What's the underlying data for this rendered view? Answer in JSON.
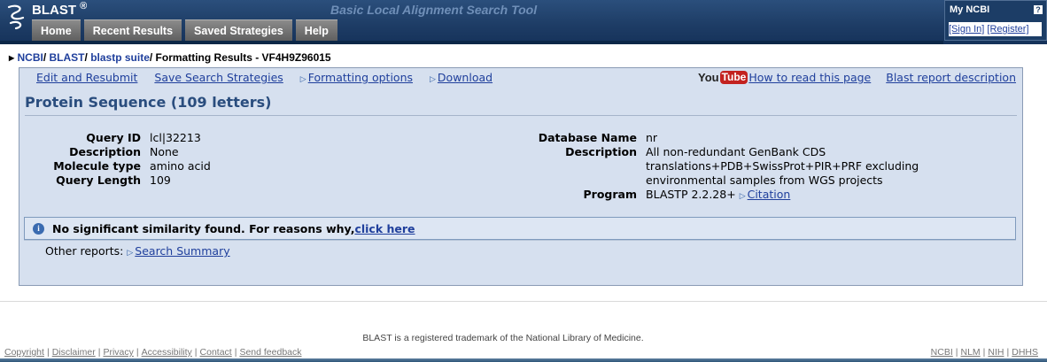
{
  "header": {
    "brand": "BLAST",
    "brand_mark": "®",
    "tool_title": "Basic Local Alignment Search Tool",
    "nav": [
      "Home",
      "Recent Results",
      "Saved Strategies",
      "Help"
    ],
    "my_ncbi": {
      "title": "My NCBI",
      "help": "?",
      "sign_in": "[Sign In]",
      "register": "[Register]"
    },
    "colors": {
      "header_bg": "#1e3d66",
      "tab_bg": "#6e6e6e",
      "panel_bg": "#d6e0ef",
      "link": "#1f3f9c"
    }
  },
  "breadcrumb": {
    "items": [
      "NCBI",
      "BLAST",
      "blastp suite"
    ],
    "current": "Formatting Results - VF4H9Z96015"
  },
  "toolbar": {
    "edit_resubmit": "Edit and Resubmit",
    "save_strategies": "Save Search Strategies",
    "formatting_options": "Formatting options",
    "download": "Download",
    "youtube_you": "You",
    "youtube_tube": "Tube",
    "how_to_read": "How to read this page",
    "report_description": "Blast report description"
  },
  "main": {
    "title": "Protein Sequence (109 letters)",
    "query_info": [
      {
        "label": "Query ID",
        "value": "lcl|32213"
      },
      {
        "label": "Description",
        "value": "None"
      },
      {
        "label": "Molecule type",
        "value": "amino acid"
      },
      {
        "label": "Query Length",
        "value": "109"
      }
    ],
    "db_info": {
      "db_name_label": "Database Name",
      "db_name": "nr",
      "description_label": "Description",
      "description": "All non-redundant GenBank CDS translations+PDB+SwissProt+PIR+PRF excluding environmental samples from WGS projects",
      "program_label": "Program",
      "program": "BLASTP 2.2.28+",
      "citation": "Citation"
    },
    "notice": {
      "icon": "i",
      "text": "No significant similarity found. For reasons why,",
      "link": "click here"
    },
    "other_reports": {
      "label": "Other reports:",
      "link": "Search Summary"
    }
  },
  "footer": {
    "trademark": "BLAST is a registered trademark of the National Library of Medicine.",
    "links_left": [
      "Copyright",
      "Disclaimer",
      "Privacy",
      "Accessibility",
      "Contact",
      "Send feedback"
    ],
    "links_right": [
      "NCBI",
      "NLM",
      "NIH",
      "DHHS"
    ]
  }
}
